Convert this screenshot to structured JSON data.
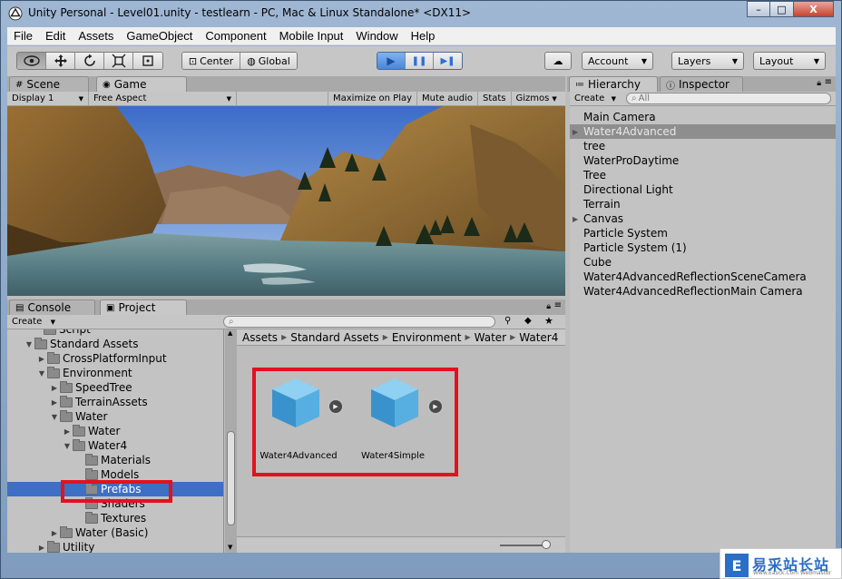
{
  "window": {
    "title": "Unity Personal - Level01.unity - testlearn - PC, Mac & Linux Standalone* <DX11>",
    "minimize": "–",
    "maximize": "□",
    "close": "X"
  },
  "menubar": [
    "File",
    "Edit",
    "Assets",
    "GameObject",
    "Component",
    "Mobile Input",
    "Window",
    "Help"
  ],
  "toolbar": {
    "tools": [
      "view-eye",
      "move",
      "rotate",
      "scale",
      "rect"
    ],
    "pivot": "Center",
    "space": "Global",
    "play": "▶",
    "pause": "❚❚",
    "step": "▶❚",
    "cloud": "☁",
    "account": "Account",
    "layers": "Layers",
    "layout": "Layout"
  },
  "game_panel": {
    "tab_scene": "Scene",
    "tab_game": "Game",
    "display": "Display 1",
    "aspect": "Free Aspect",
    "maximize_on_play": "Maximize on Play",
    "mute_audio": "Mute audio",
    "stats": "Stats",
    "gizmos": "Gizmos"
  },
  "hierarchy": {
    "tab_hierarchy": "Hierarchy",
    "tab_inspector": "Inspector",
    "create": "Create",
    "search_placeholder": "All",
    "items": [
      {
        "label": "Main Camera",
        "arrow": ""
      },
      {
        "label": "Water4Advanced",
        "arrow": "▶"
      },
      {
        "label": "tree",
        "arrow": ""
      },
      {
        "label": "WaterProDaytime",
        "arrow": ""
      },
      {
        "label": "Tree",
        "arrow": ""
      },
      {
        "label": "Directional Light",
        "arrow": ""
      },
      {
        "label": "Terrain",
        "arrow": ""
      },
      {
        "label": "Canvas",
        "arrow": "▶"
      },
      {
        "label": "Particle System",
        "arrow": ""
      },
      {
        "label": "Particle System (1)",
        "arrow": ""
      },
      {
        "label": "Cube",
        "arrow": ""
      },
      {
        "label": "Water4AdvancedReflectionSceneCamera",
        "arrow": ""
      },
      {
        "label": "Water4AdvancedReflectionMain Camera",
        "arrow": ""
      }
    ]
  },
  "project_panel": {
    "tab_console": "Console",
    "tab_project": "Project",
    "create": "Create",
    "tree": [
      {
        "label": "Script",
        "arrow": ""
      },
      {
        "label": "Standard Assets",
        "arrow": "▼"
      },
      {
        "label": "CrossPlatformInput",
        "arrow": "▶"
      },
      {
        "label": "Environment",
        "arrow": "▼"
      },
      {
        "label": "SpeedTree",
        "arrow": "▶"
      },
      {
        "label": "TerrainAssets",
        "arrow": "▶"
      },
      {
        "label": "Water",
        "arrow": "▼"
      },
      {
        "label": "Water",
        "arrow": "▶"
      },
      {
        "label": "Water4",
        "arrow": "▼"
      },
      {
        "label": "Materials",
        "arrow": ""
      },
      {
        "label": "Models",
        "arrow": ""
      },
      {
        "label": "Prefabs",
        "arrow": ""
      },
      {
        "label": "Shaders",
        "arrow": ""
      },
      {
        "label": "Textures",
        "arrow": ""
      },
      {
        "label": "Water (Basic)",
        "arrow": "▶"
      },
      {
        "label": "Utility",
        "arrow": "▶"
      }
    ],
    "breadcrumb": [
      "Assets",
      "Standard Assets",
      "Environment",
      "Water",
      "Water4"
    ],
    "assets": [
      {
        "label": "Water4Advanced"
      },
      {
        "label": "Water4Simple"
      }
    ]
  },
  "watermark": {
    "logo": "E",
    "text": "易采站长站",
    "sub": "Www.Easck.Com  Webmaster"
  },
  "colors": {
    "selection": "#3d6fc4",
    "highlight_box": "#e1121e",
    "play_accent": "#2d6fd6"
  }
}
